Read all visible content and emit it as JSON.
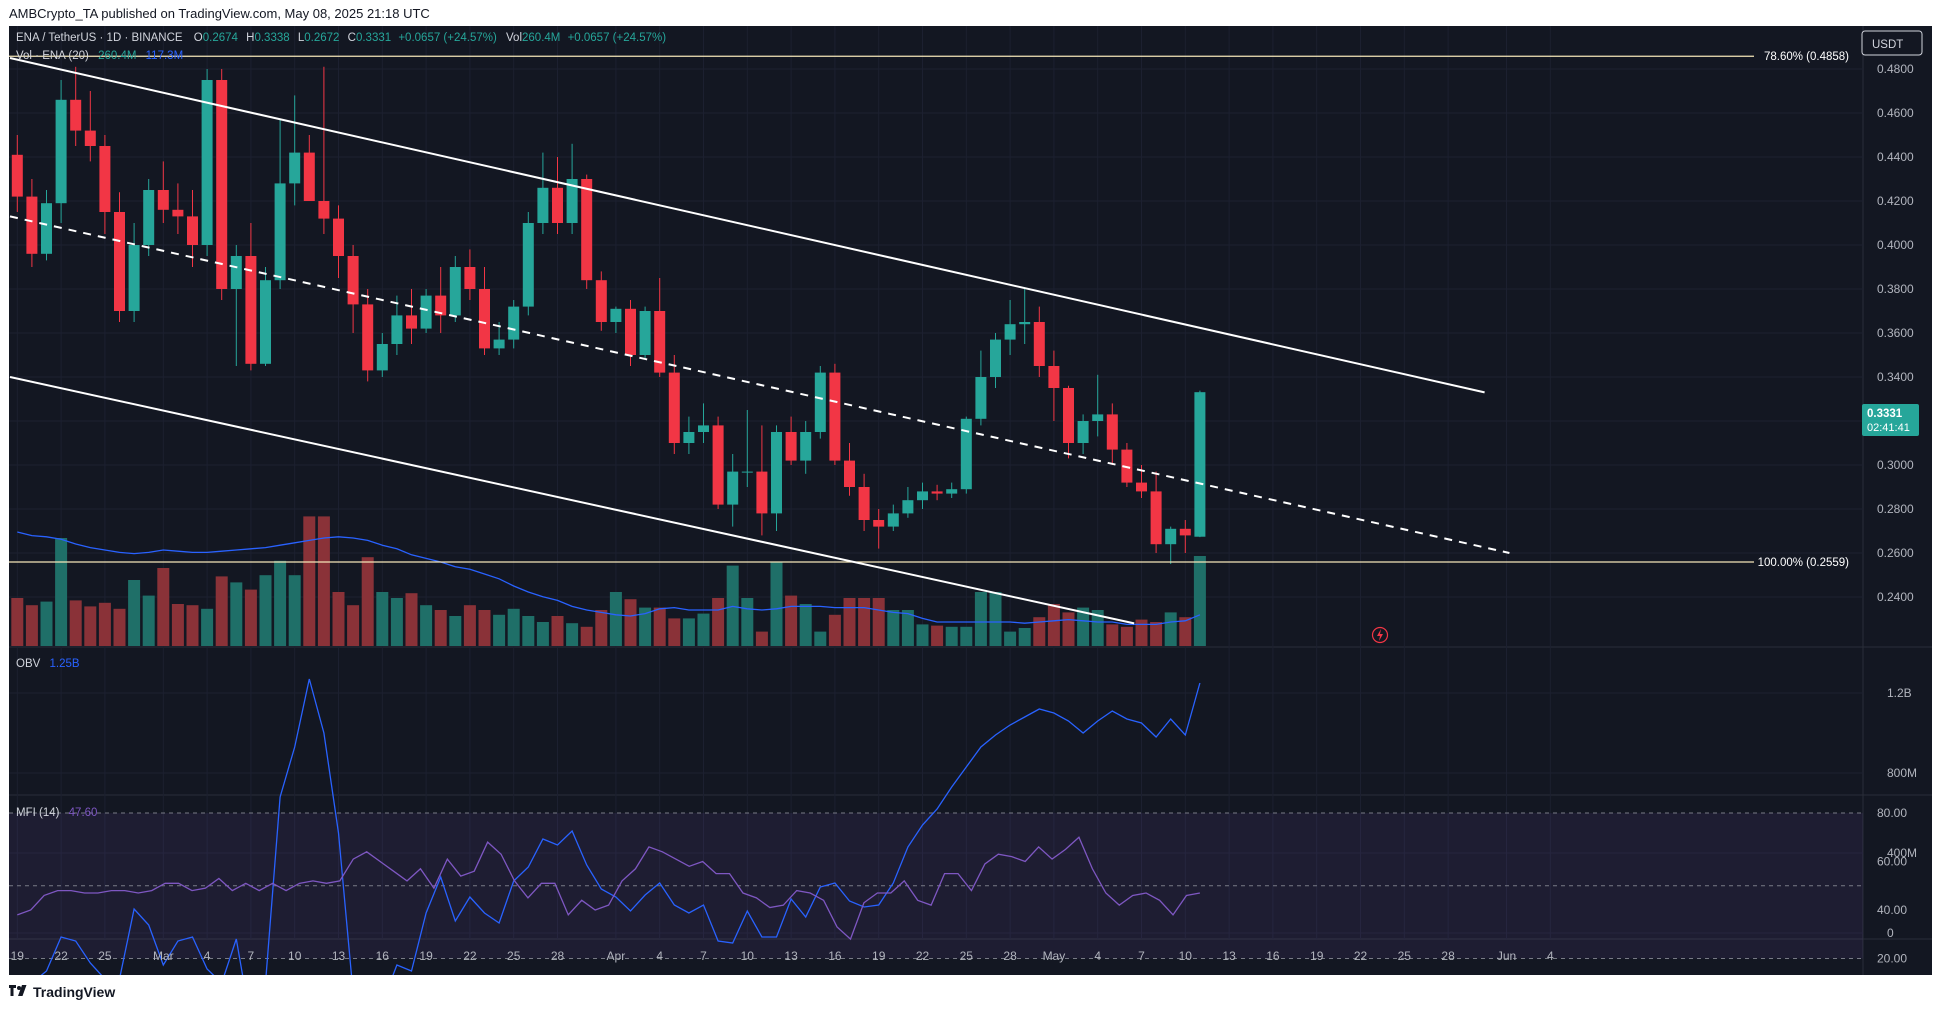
{
  "header": {
    "published_by": "AMBCrypto_TA published on TradingView.com, May 08, 2025 21:18 UTC"
  },
  "footer": {
    "brand": "TradingView"
  },
  "legend": {
    "symbol": "ENA / TetherUS · 1D · BINANCE",
    "open_label": "O",
    "open": "0.2674",
    "high_label": "H",
    "high": "0.3338",
    "low_label": "L",
    "low": "0.2672",
    "close_label": "C",
    "close": "0.3331",
    "change": "+0.0657 (+24.57%)",
    "vol_label": "Vol",
    "vol": "260.4M",
    "vol_change": "+0.0657 (+24.57%)",
    "vol_indicator": "Vol · ENA (20)",
    "vol_value": "260.4M",
    "vol_ma": "117.3M",
    "obv_label": "OBV",
    "obv_value": "1.25B",
    "mfi_label": "MFI (14)",
    "mfi_value": "47.60"
  },
  "currency_label": "USDT",
  "price_tag": {
    "price": "0.3331",
    "countdown": "02:41:41"
  },
  "colors": {
    "background": "#131722",
    "up": "#26a69a",
    "down": "#f23645",
    "up_volume": "#1f6f68",
    "down_volume": "#8a3238",
    "vol_ma": "#2962ff",
    "obv": "#2962ff",
    "mfi": "#7e57c2",
    "fib_line": "#f5e6b8",
    "channel": "#ffffff",
    "text": "#d1d4dc",
    "axis_text": "#b2b5be"
  },
  "chart_data": [
    {
      "type": "candlestick",
      "title": "ENA / TetherUS · 1D · BINANCE",
      "y_axis_ticks": [
        "0.4800",
        "0.4600",
        "0.4400",
        "0.4200",
        "0.4000",
        "0.3800",
        "0.3600",
        "0.3400",
        "0.3200",
        "0.3000",
        "0.2800",
        "0.2600",
        "0.2400"
      ],
      "ylim": [
        0.2281,
        0.4923
      ],
      "x_axis_ticks": [
        {
          "label": "19",
          "day": 0
        },
        {
          "label": "22",
          "day": 3
        },
        {
          "label": "25",
          "day": 6
        },
        {
          "label": "Mar",
          "day": 10
        },
        {
          "label": "4",
          "day": 13
        },
        {
          "label": "7",
          "day": 16
        },
        {
          "label": "10",
          "day": 19
        },
        {
          "label": "13",
          "day": 22
        },
        {
          "label": "16",
          "day": 25
        },
        {
          "label": "19",
          "day": 28
        },
        {
          "label": "22",
          "day": 31
        },
        {
          "label": "25",
          "day": 34
        },
        {
          "label": "28",
          "day": 37
        },
        {
          "label": "Apr",
          "day": 41
        },
        {
          "label": "4",
          "day": 44
        },
        {
          "label": "7",
          "day": 47
        },
        {
          "label": "10",
          "day": 50
        },
        {
          "label": "13",
          "day": 53
        },
        {
          "label": "16",
          "day": 56
        },
        {
          "label": "19",
          "day": 59
        },
        {
          "label": "22",
          "day": 62
        },
        {
          "label": "25",
          "day": 65
        },
        {
          "label": "28",
          "day": 68
        },
        {
          "label": "May",
          "day": 71
        },
        {
          "label": "4",
          "day": 74
        },
        {
          "label": "7",
          "day": 77
        },
        {
          "label": "10",
          "day": 80
        },
        {
          "label": "13",
          "day": 83
        },
        {
          "label": "16",
          "day": 86
        },
        {
          "label": "19",
          "day": 89
        },
        {
          "label": "22",
          "day": 92
        },
        {
          "label": "25",
          "day": 95
        },
        {
          "label": "28",
          "day": 98
        },
        {
          "label": "Jun",
          "day": 102
        },
        {
          "label": "4",
          "day": 105
        }
      ],
      "x_first_date": "2025-02-19",
      "candles": [
        [
          0.441,
          0.45,
          0.415,
          0.422
        ],
        [
          0.422,
          0.43,
          0.39,
          0.396
        ],
        [
          0.396,
          0.425,
          0.393,
          0.419
        ],
        [
          0.419,
          0.475,
          0.41,
          0.466
        ],
        [
          0.466,
          0.481,
          0.445,
          0.452
        ],
        [
          0.452,
          0.47,
          0.438,
          0.445
        ],
        [
          0.445,
          0.45,
          0.405,
          0.415
        ],
        [
          0.415,
          0.424,
          0.365,
          0.37
        ],
        [
          0.37,
          0.41,
          0.365,
          0.4
        ],
        [
          0.4,
          0.43,
          0.395,
          0.425
        ],
        [
          0.425,
          0.438,
          0.41,
          0.416
        ],
        [
          0.416,
          0.428,
          0.405,
          0.413
        ],
        [
          0.413,
          0.425,
          0.39,
          0.4
        ],
        [
          0.4,
          0.48,
          0.395,
          0.475
        ],
        [
          0.475,
          0.48,
          0.375,
          0.38
        ],
        [
          0.38,
          0.4,
          0.345,
          0.395
        ],
        [
          0.395,
          0.41,
          0.343,
          0.346
        ],
        [
          0.346,
          0.39,
          0.345,
          0.384
        ],
        [
          0.384,
          0.457,
          0.38,
          0.428
        ],
        [
          0.428,
          0.468,
          0.418,
          0.442
        ],
        [
          0.442,
          0.45,
          0.42,
          0.42
        ],
        [
          0.42,
          0.481,
          0.405,
          0.412
        ],
        [
          0.412,
          0.418,
          0.385,
          0.395
        ],
        [
          0.395,
          0.4,
          0.36,
          0.373
        ],
        [
          0.373,
          0.38,
          0.338,
          0.343
        ],
        [
          0.343,
          0.36,
          0.34,
          0.355
        ],
        [
          0.355,
          0.377,
          0.35,
          0.368
        ],
        [
          0.368,
          0.38,
          0.355,
          0.362
        ],
        [
          0.362,
          0.38,
          0.36,
          0.377
        ],
        [
          0.377,
          0.39,
          0.36,
          0.368
        ],
        [
          0.368,
          0.395,
          0.365,
          0.39
        ],
        [
          0.39,
          0.398,
          0.375,
          0.38
        ],
        [
          0.38,
          0.39,
          0.35,
          0.353
        ],
        [
          0.353,
          0.365,
          0.35,
          0.357
        ],
        [
          0.357,
          0.375,
          0.353,
          0.372
        ],
        [
          0.372,
          0.415,
          0.368,
          0.41
        ],
        [
          0.41,
          0.442,
          0.405,
          0.426
        ],
        [
          0.426,
          0.44,
          0.405,
          0.41
        ],
        [
          0.41,
          0.446,
          0.405,
          0.43
        ],
        [
          0.43,
          0.432,
          0.38,
          0.384
        ],
        [
          0.384,
          0.388,
          0.361,
          0.365
        ],
        [
          0.365,
          0.372,
          0.36,
          0.371
        ],
        [
          0.371,
          0.375,
          0.345,
          0.35
        ],
        [
          0.35,
          0.372,
          0.348,
          0.37
        ],
        [
          0.37,
          0.385,
          0.34,
          0.342
        ],
        [
          0.342,
          0.35,
          0.305,
          0.31
        ],
        [
          0.31,
          0.322,
          0.305,
          0.315
        ],
        [
          0.315,
          0.328,
          0.31,
          0.318
        ],
        [
          0.318,
          0.322,
          0.28,
          0.282
        ],
        [
          0.282,
          0.305,
          0.272,
          0.297
        ],
        [
          0.297,
          0.325,
          0.29,
          0.297
        ],
        [
          0.297,
          0.318,
          0.268,
          0.278
        ],
        [
          0.278,
          0.318,
          0.27,
          0.315
        ],
        [
          0.315,
          0.322,
          0.3,
          0.302
        ],
        [
          0.302,
          0.32,
          0.296,
          0.315
        ],
        [
          0.315,
          0.345,
          0.312,
          0.342
        ],
        [
          0.342,
          0.346,
          0.3,
          0.302
        ],
        [
          0.302,
          0.31,
          0.286,
          0.29
        ],
        [
          0.29,
          0.296,
          0.27,
          0.275
        ],
        [
          0.275,
          0.28,
          0.262,
          0.272
        ],
        [
          0.272,
          0.282,
          0.27,
          0.278
        ],
        [
          0.278,
          0.29,
          0.276,
          0.284
        ],
        [
          0.284,
          0.292,
          0.28,
          0.288
        ],
        [
          0.288,
          0.291,
          0.284,
          0.287
        ],
        [
          0.287,
          0.292,
          0.285,
          0.289
        ],
        [
          0.289,
          0.322,
          0.287,
          0.321
        ],
        [
          0.321,
          0.352,
          0.318,
          0.34
        ],
        [
          0.34,
          0.36,
          0.335,
          0.357
        ],
        [
          0.357,
          0.375,
          0.35,
          0.364
        ],
        [
          0.364,
          0.38,
          0.355,
          0.365
        ],
        [
          0.365,
          0.372,
          0.34,
          0.345
        ],
        [
          0.345,
          0.352,
          0.32,
          0.335
        ],
        [
          0.335,
          0.336,
          0.303,
          0.31
        ],
        [
          0.31,
          0.323,
          0.305,
          0.32
        ],
        [
          0.32,
          0.341,
          0.313,
          0.323
        ],
        [
          0.323,
          0.328,
          0.3,
          0.307
        ],
        [
          0.307,
          0.31,
          0.29,
          0.292
        ],
        [
          0.292,
          0.3,
          0.285,
          0.288
        ],
        [
          0.288,
          0.297,
          0.26,
          0.264
        ],
        [
          0.264,
          0.272,
          0.255,
          0.271
        ],
        [
          0.271,
          0.275,
          0.26,
          0.268
        ],
        [
          0.2674,
          0.3338,
          0.2672,
          0.3331
        ]
      ],
      "volume_ylim": [
        0,
        90
      ],
      "volume": [
        40,
        34,
        37,
        90,
        38,
        33,
        36,
        31,
        55,
        42,
        65,
        35,
        34,
        31,
        58,
        53,
        47,
        59,
        71,
        59,
        108,
        108,
        45,
        34,
        74,
        45,
        40,
        44,
        34,
        30,
        25,
        34,
        30,
        26,
        31,
        25,
        20,
        25,
        19,
        16,
        30,
        45,
        39,
        32,
        32,
        23,
        23,
        27,
        40,
        67,
        40,
        12,
        70,
        42,
        35,
        12,
        26,
        40,
        40,
        40,
        30,
        30,
        18,
        17,
        16,
        16,
        45,
        45,
        12,
        15,
        24,
        35,
        28,
        32,
        30,
        18,
        16,
        22,
        20,
        28,
        24,
        75
      ],
      "volume_ma": [
        95,
        92,
        91,
        89,
        85,
        82,
        80,
        78,
        77,
        78,
        80,
        79,
        78,
        78,
        79,
        80,
        81,
        82,
        84,
        86,
        88,
        90,
        91,
        90,
        88,
        84,
        81,
        76,
        73,
        70,
        66,
        64,
        60,
        56,
        50,
        45,
        41,
        38,
        33,
        30,
        28,
        26,
        25,
        27,
        31,
        32,
        30,
        30,
        30,
        33,
        31,
        30,
        31,
        33,
        33,
        33,
        32,
        32,
        32,
        30,
        28,
        27,
        23,
        20,
        20,
        20,
        20,
        20,
        20,
        19,
        20,
        21,
        22,
        21,
        20,
        20,
        18,
        18,
        18,
        20,
        21,
        26
      ],
      "annotations": [
        {
          "label": "78.60% (0.4858)",
          "price": 0.4858
        },
        {
          "label": "100.00% (0.2559)",
          "price": 0.2559
        }
      ],
      "channel": {
        "upper": [
          [
            -0.5,
            0.485
          ],
          [
            100.5,
            0.333
          ]
        ],
        "mid": [
          [
            -0.5,
            0.413
          ],
          [
            102.2,
            0.26
          ]
        ],
        "lower": [
          [
            -0.5,
            0.34
          ],
          [
            76.5,
            0.228
          ]
        ]
      }
    },
    {
      "type": "line",
      "title": "OBV",
      "y_axis_ticks": [
        "1.2B",
        "800M",
        "400M",
        "0"
      ],
      "ylim": [
        -300,
        1500
      ],
      "values": [
        -300,
        -250,
        -190,
        -20,
        -40,
        -150,
        -230,
        -230,
        120,
        40,
        -160,
        -40,
        -20,
        -180,
        -250,
        -30,
        -450,
        -250,
        680,
        930,
        1270,
        1000,
        500,
        -300,
        -300,
        -350,
        -160,
        -190,
        100,
        280,
        60,
        180,
        100,
        50,
        260,
        330,
        470,
        440,
        510,
        340,
        220,
        180,
        110,
        190,
        250,
        140,
        100,
        140,
        -40,
        -50,
        110,
        -20,
        -20,
        170,
        80,
        230,
        250,
        160,
        130,
        140,
        250,
        430,
        540,
        620,
        730,
        830,
        930,
        990,
        1040,
        1080,
        1120,
        1100,
        1060,
        1000,
        1060,
        1110,
        1070,
        1050,
        980,
        1070,
        990,
        1250
      ],
      "y_unit": "M"
    },
    {
      "type": "line",
      "title": "MFI (14)",
      "y_axis_ticks": [
        "80.00",
        "60.00",
        "40.00",
        "20.00"
      ],
      "ylim": [
        15,
        85
      ],
      "band": [
        20,
        80
      ],
      "values": [
        38,
        40,
        46,
        48,
        48,
        47,
        47,
        48,
        48,
        47,
        48,
        51,
        51,
        48,
        49,
        53,
        48,
        51,
        48,
        51,
        48,
        51,
        52,
        51,
        52,
        61,
        64,
        60,
        56,
        52,
        57,
        49,
        61,
        54,
        56,
        68,
        63,
        52,
        45,
        51,
        51,
        38,
        44,
        40,
        42,
        52,
        57,
        66,
        64,
        61,
        58,
        60,
        55,
        55,
        47,
        45,
        41,
        42,
        48,
        47,
        44,
        33,
        28,
        43,
        47,
        47,
        52,
        44,
        42,
        55,
        55,
        48,
        59,
        63,
        62,
        60,
        66,
        61,
        65,
        70,
        57,
        47,
        42,
        46,
        47,
        44,
        38,
        46,
        47
      ]
    }
  ]
}
